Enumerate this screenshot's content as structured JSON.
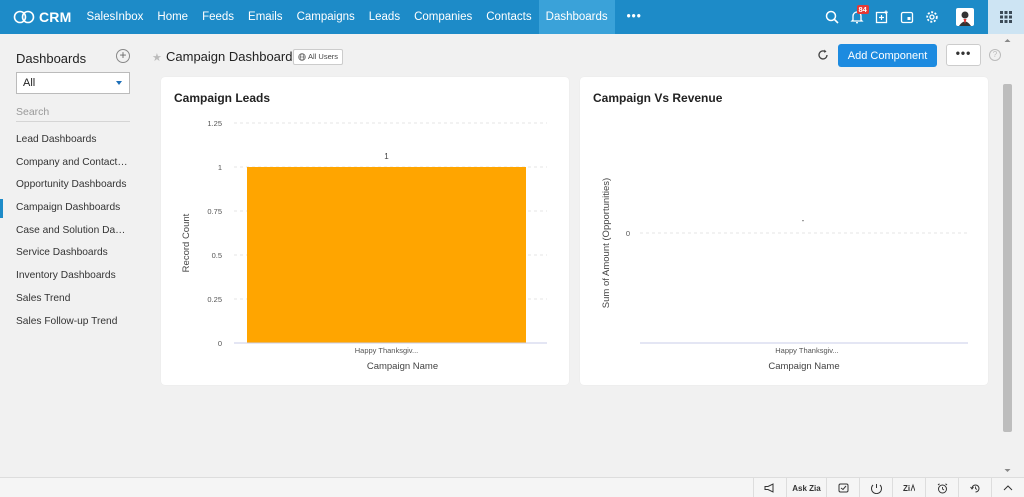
{
  "app": {
    "brand": "CRM"
  },
  "nav": {
    "items": [
      {
        "label": "SalesInbox",
        "active": false
      },
      {
        "label": "Home",
        "active": false
      },
      {
        "label": "Feeds",
        "active": false
      },
      {
        "label": "Emails",
        "active": false
      },
      {
        "label": "Campaigns",
        "active": false
      },
      {
        "label": "Leads",
        "active": false
      },
      {
        "label": "Companies",
        "active": false
      },
      {
        "label": "Contacts",
        "active": false
      },
      {
        "label": "Dashboards",
        "active": true
      }
    ],
    "more_label": "•••",
    "notification_count": "84"
  },
  "sidebar": {
    "title": "Dashboards",
    "add_symbol": "+",
    "filter_value": "All",
    "search_placeholder": "Search",
    "items": [
      {
        "label": "Lead Dashboards"
      },
      {
        "label": "Company and Contact Dashboards"
      },
      {
        "label": "Opportunity Dashboards"
      },
      {
        "label": "Campaign Dashboards"
      },
      {
        "label": "Case and Solution Dashboards"
      },
      {
        "label": "Service Dashboards"
      },
      {
        "label": "Inventory Dashboards"
      },
      {
        "label": "Sales Trend"
      },
      {
        "label": "Sales Follow-up Trend"
      }
    ],
    "active_index": 3
  },
  "header": {
    "title": "Campaign Dashboards",
    "visibility_label": "All Users",
    "add_component_label": "Add Component",
    "more_label": "•••",
    "help_label": "?"
  },
  "chart_data": [
    {
      "type": "bar",
      "title": "Campaign Leads",
      "categories": [
        "Happy Thanksgiv..."
      ],
      "values": [
        1
      ],
      "data_labels": [
        "1"
      ],
      "xlabel": "Campaign Name",
      "ylabel": "Record Count",
      "ylim": [
        0,
        1.25
      ],
      "yticks": [
        0,
        0.25,
        0.5,
        0.75,
        1,
        1.25
      ],
      "ytick_labels": [
        "0",
        "0.25",
        "0.5",
        "0.75",
        "1",
        "1.25"
      ],
      "bar_color": "#ffa500",
      "grid": true
    },
    {
      "type": "bar",
      "title": "Campaign Vs Revenue",
      "categories": [
        "Happy Thanksgiv..."
      ],
      "values": [
        0
      ],
      "data_labels": [
        "-"
      ],
      "xlabel": "Campaign Name",
      "ylabel": "Sum of Amount (Opportunities)",
      "yticks": [
        0
      ],
      "ytick_labels": [
        "0"
      ],
      "grid": true
    }
  ],
  "footer": {
    "ask_zia_label": "Ask Zia"
  },
  "colors": {
    "nav_bg": "#1d8bc8",
    "nav_active": "#3aa2d9",
    "primary_button": "#1d8be0",
    "bar": "#ffa500"
  }
}
